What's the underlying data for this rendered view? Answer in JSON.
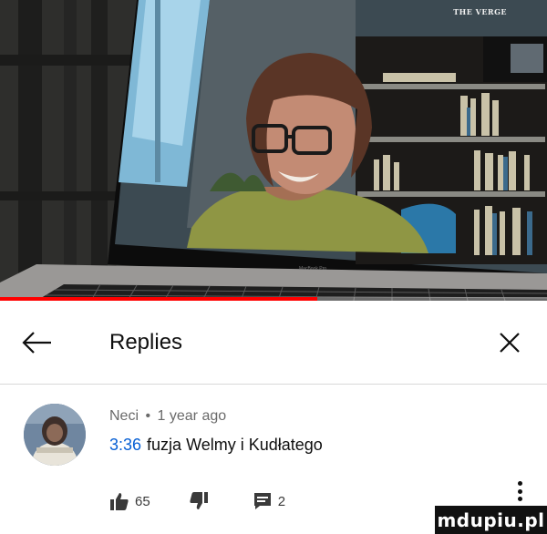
{
  "video": {
    "channel_watermark": "THE VERGE",
    "laptop_brand": "MacBook Pro",
    "progress_fraction": 0.58
  },
  "replies_panel": {
    "title": "Replies",
    "back_icon": "arrow-left-icon",
    "close_icon": "close-icon"
  },
  "comment": {
    "author": "Neci",
    "separator": "•",
    "age": "1 year ago",
    "timestamp": "3:36",
    "text": "fuzja Welmy i Kudłatego",
    "likes": "65",
    "replies": "2",
    "icons": [
      "thumbs-up-icon",
      "thumbs-down-icon",
      "reply-icon",
      "more-vertical-icon"
    ]
  },
  "site_watermark": "mdupiu.pl",
  "colors": {
    "timestamp_link": "#065fd4",
    "progress": "#ff0000",
    "meta_text": "#6a6a6a"
  }
}
